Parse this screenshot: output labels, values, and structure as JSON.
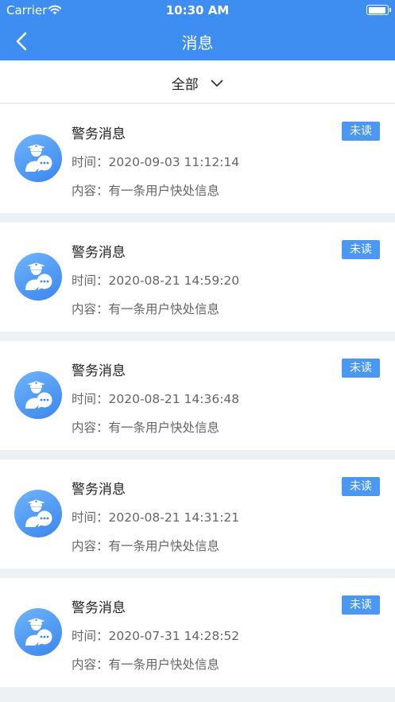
{
  "status_bar": {
    "carrier": "Carrier",
    "time": "10:30 AM"
  },
  "nav": {
    "title": "消息"
  },
  "filter": {
    "label": "全部"
  },
  "messages": [
    {
      "title": "警务消息",
      "time_label": "时间：",
      "time": "2020-09-03 11:12:14",
      "content_label": "内容：",
      "content": "有一条用户快处信息",
      "badge": "未读"
    },
    {
      "title": "警务消息",
      "time_label": "时间：",
      "time": "2020-08-21 14:59:20",
      "content_label": "内容：",
      "content": "有一条用户快处信息",
      "badge": "未读"
    },
    {
      "title": "警务消息",
      "time_label": "时间：",
      "time": "2020-08-21 14:36:48",
      "content_label": "内容：",
      "content": "有一条用户快处信息",
      "badge": "未读"
    },
    {
      "title": "警务消息",
      "time_label": "时间：",
      "time": "2020-08-21 14:31:21",
      "content_label": "内容：",
      "content": "有一条用户快处信息",
      "badge": "未读"
    },
    {
      "title": "警务消息",
      "time_label": "时间：",
      "time": "2020-07-31 14:28:52",
      "content_label": "内容：",
      "content": "有一条用户快处信息",
      "badge": "未读"
    }
  ],
  "colors": {
    "accent": "#3d8ef0",
    "badge": "#4a98f2",
    "background": "#eef1f3"
  },
  "icons": {
    "back": "chevron-left-icon",
    "filter": "chevron-down-icon",
    "avatar": "police-message-icon",
    "wifi": "wifi-icon",
    "battery": "battery-icon"
  }
}
